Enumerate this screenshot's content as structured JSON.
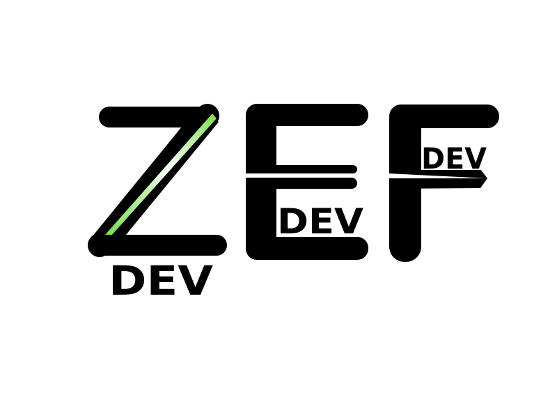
{
  "logo": {
    "wordmark": "ZEF",
    "wordmark_letters": [
      "Z",
      "E",
      "F"
    ],
    "sub_labels": {
      "z": "DEV",
      "e": "DEV",
      "f": "DEV"
    }
  },
  "colors": {
    "background": "#ffffff",
    "letter_fill": "#000000",
    "accent_green": "#5fd92e",
    "accent_highlight": "#ffffff"
  }
}
